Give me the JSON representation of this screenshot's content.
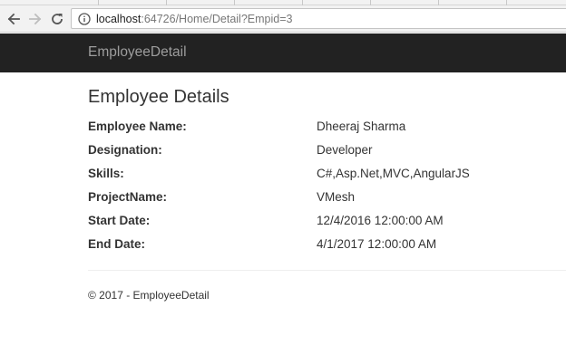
{
  "browser": {
    "url_host": "localhost",
    "url_rest": ":64726/Home/Detail?Empid=3"
  },
  "app": {
    "brand": "EmployeeDetail"
  },
  "page": {
    "title": "Employee Details",
    "fields": [
      {
        "label": "Employee Name:",
        "value": "Dheeraj Sharma"
      },
      {
        "label": "Designation:",
        "value": "Developer"
      },
      {
        "label": "Skills:",
        "value": "C#,Asp.Net,MVC,AngularJS"
      },
      {
        "label": "ProjectName:",
        "value": "VMesh"
      },
      {
        "label": "Start Date:",
        "value": "12/4/2016 12:00:00 AM"
      },
      {
        "label": "End Date:",
        "value": "4/1/2017 12:00:00 AM"
      }
    ]
  },
  "footer": {
    "text": "© 2017 - EmployeeDetail"
  }
}
